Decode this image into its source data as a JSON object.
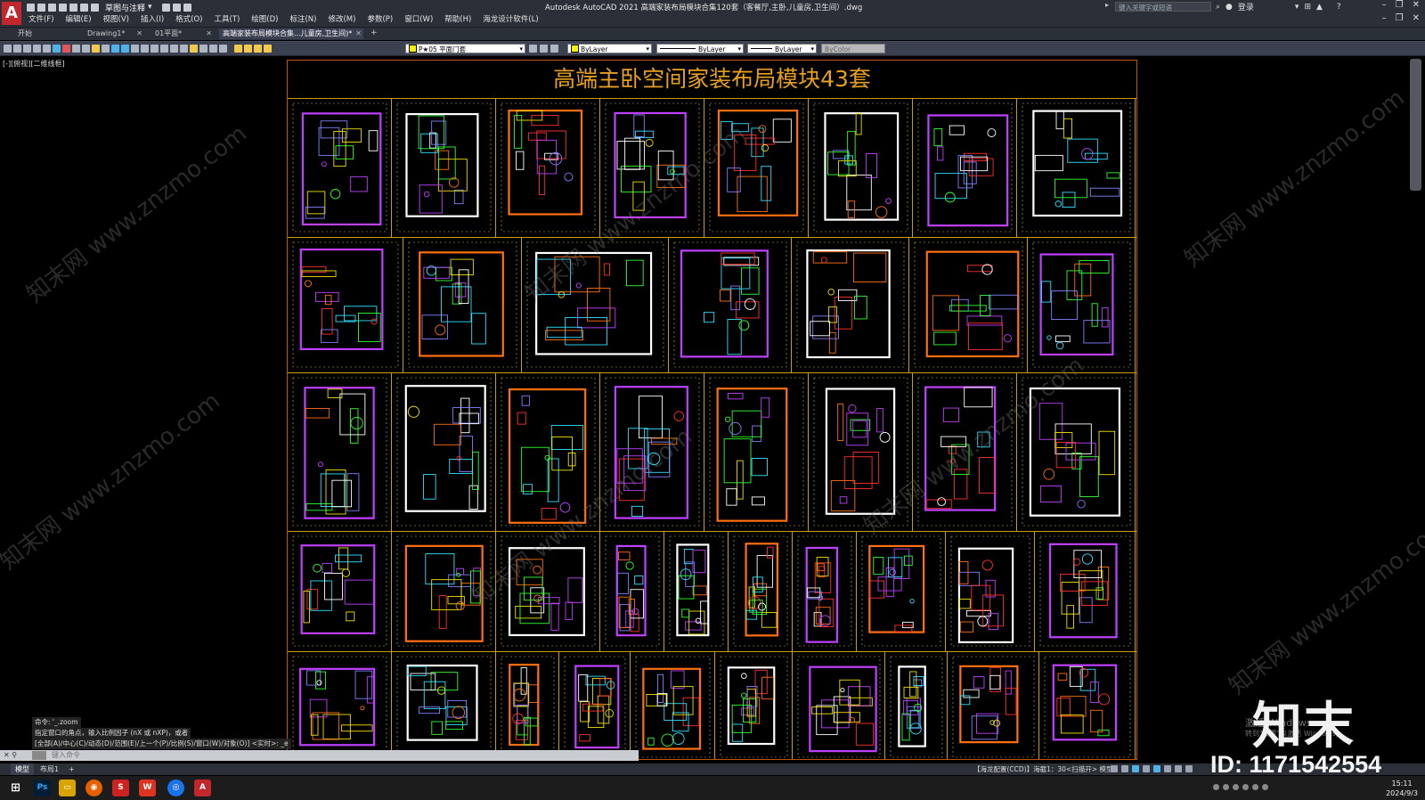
{
  "app": {
    "title": "Autodesk AutoCAD 2021    高端家装布局模块合集120套（客餐厅,主卧,儿童房,卫生间）.dwg",
    "logo": "A",
    "workspace": "草图与注释",
    "search_placeholder": "键入关键字或短语",
    "login": "登录"
  },
  "menu": [
    "文件(F)",
    "编辑(E)",
    "视图(V)",
    "插入(I)",
    "格式(O)",
    "工具(T)",
    "绘图(D)",
    "标注(N)",
    "修改(M)",
    "参数(P)",
    "窗口(W)",
    "帮助(H)",
    "海龙设计软件(L)"
  ],
  "tabs": [
    {
      "label": "开始",
      "active": false
    },
    {
      "label": "Drawing1*",
      "active": false
    },
    {
      "label": "01平面*",
      "active": false
    },
    {
      "label": "高端家装布局模块合集...儿童房,卫生间)*",
      "active": true
    }
  ],
  "toolbar": {
    "layer_combo": "P★05 平面门套",
    "color_combo": "ByLayer",
    "linetype_combo": "ByLayer",
    "lineweight_combo": "ByLayer",
    "plotstyle_combo": "ByColor"
  },
  "viewport": {
    "label": "[-][俯视][二维线框]"
  },
  "drawing": {
    "title": "高端主卧空间家装布局模块43套",
    "colors": {
      "frame": "#c0520a",
      "grid": "#c8a000",
      "title": "#e6a01e"
    }
  },
  "command": {
    "history": [
      "命令: '_.zoom",
      "指定窗口的角点，输入比例因子 (nX 或 nXP)，或者",
      "[全部(A)/中心(C)/动态(D)/范围(E)/上一个(P)/比例(S)/窗口(W)/对象(O)] <实时>: _e"
    ],
    "placeholder": "键入命令"
  },
  "layout_tabs": [
    "模型",
    "布局1"
  ],
  "status": {
    "text": "【海龙配置(CCD)】海截1：30<扫描开>  模型"
  },
  "clock": {
    "time": "15:11",
    "date": "2024/9/3"
  },
  "watermark": {
    "text": "知末网 www.znzmo.com",
    "brand": "知末",
    "id": "ID: 1171542554",
    "activate_1": "激活 Windows",
    "activate_2": "转到\"设置\"以激活 Windows。"
  }
}
